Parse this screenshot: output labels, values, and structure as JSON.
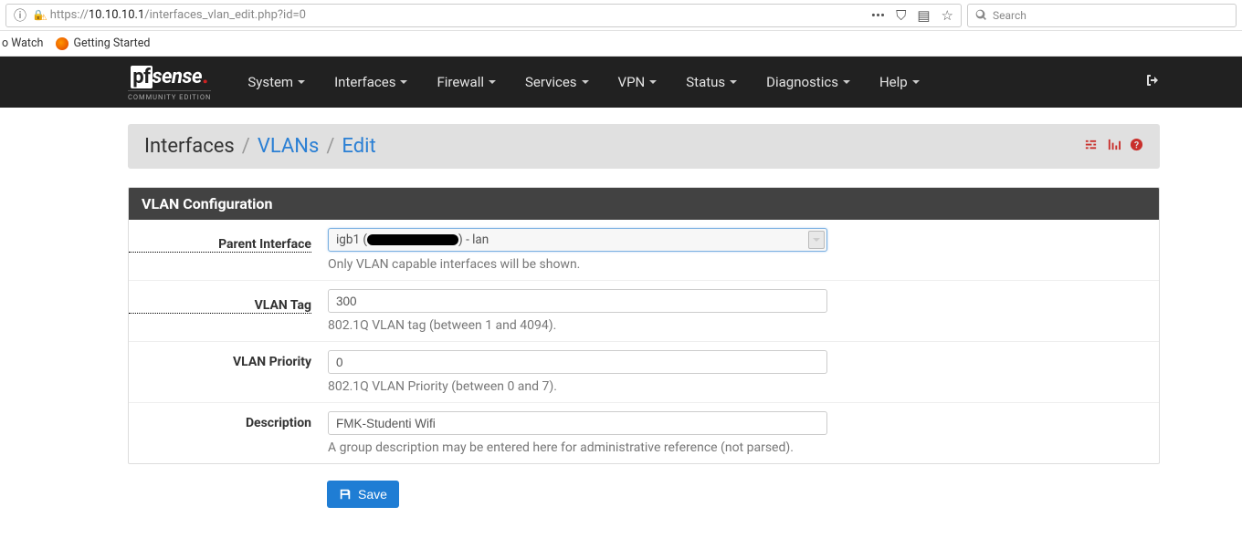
{
  "browser": {
    "url_prefix": "https://",
    "url_host": "10.10.10.1",
    "url_path": "/interfaces_vlan_edit.php?id=0",
    "search_placeholder": "Search"
  },
  "bookmarks": {
    "watch": "o Watch",
    "getting_started": "Getting Started"
  },
  "logo": {
    "pf": "pf",
    "sense": "sense",
    "sub": "COMMUNITY EDITION"
  },
  "nav": {
    "system": "System",
    "interfaces": "Interfaces",
    "firewall": "Firewall",
    "services": "Services",
    "vpn": "VPN",
    "status": "Status",
    "diagnostics": "Diagnostics",
    "help": "Help"
  },
  "breadcrumb": {
    "root": "Interfaces",
    "vlans": "VLANs",
    "edit": "Edit"
  },
  "panel": {
    "title": "VLAN Configuration"
  },
  "form": {
    "parent_label": "Parent Interface",
    "parent_value_pre": "igb1 (",
    "parent_value_post": ") - lan",
    "parent_help": "Only VLAN capable interfaces will be shown.",
    "tag_label": "VLAN Tag",
    "tag_value": "300",
    "tag_help": "802.1Q VLAN tag (between 1 and 4094).",
    "prio_label": "VLAN Priority",
    "prio_value": "0",
    "prio_help": "802.1Q VLAN Priority (between 0 and 7).",
    "desc_label": "Description",
    "desc_value": "FMK-Studenti Wifi",
    "desc_help": "A group description may be entered here for administrative reference (not parsed).",
    "save": "Save"
  }
}
